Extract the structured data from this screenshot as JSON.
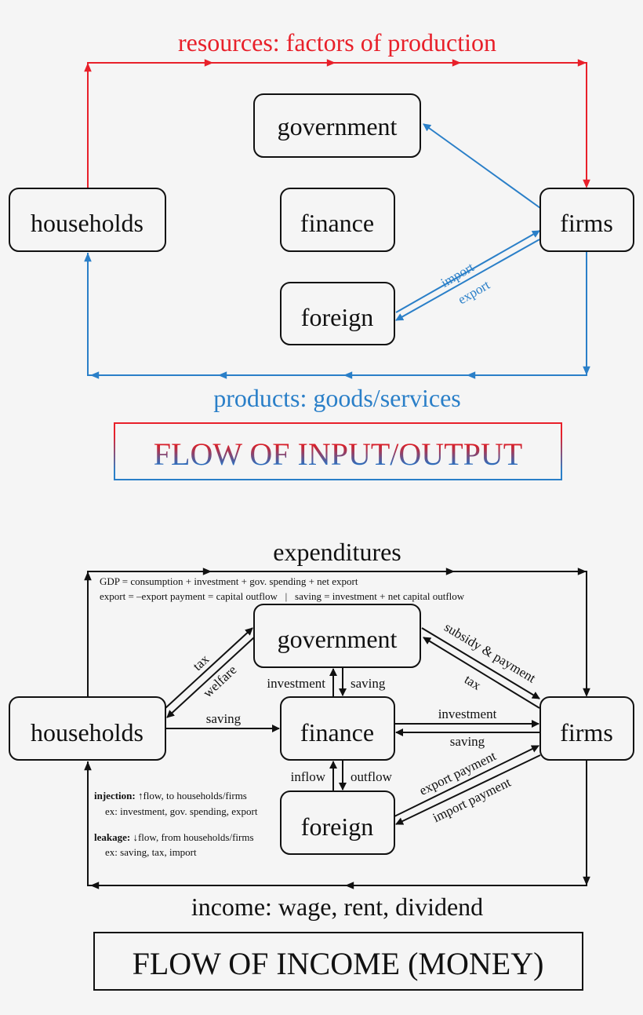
{
  "colors": {
    "input_flow": "#e8202a",
    "output_flow": "#2a7fc8",
    "money_flow": "#111111",
    "background": "#f5f5f5"
  },
  "top": {
    "resources_label": "resources: factors of production",
    "products_label": "products: goods/services",
    "title": "FLOW OF INPUT/OUTPUT",
    "nodes": {
      "government": "government",
      "households": "households",
      "finance": "finance",
      "firms": "firms",
      "foreign": "foreign"
    },
    "import_label": "import",
    "export_label": "export"
  },
  "bottom": {
    "expenditures_label": "expenditures",
    "gdp_note": "GDP = consumption + investment + gov. spending + net export",
    "export_note": "export = –export payment = capital outflow   |   saving = investment + net capital outflow",
    "income_label": "income: wage, rent, dividend",
    "title": "FLOW OF INCOME (MONEY)",
    "nodes": {
      "government": "government",
      "households": "households",
      "finance": "finance",
      "firms": "firms",
      "foreign": "foreign"
    },
    "flows": {
      "tax_households": "tax",
      "welfare": "welfare",
      "saving_households": "saving",
      "investment_gov": "investment",
      "saving_gov": "saving",
      "subsidy": "subsidy & payment",
      "tax_firms": "tax",
      "investment_firms": "investment",
      "saving_firms": "saving",
      "inflow": "inflow",
      "outflow": "outflow",
      "export_payment": "export payment",
      "import_payment": "import payment"
    },
    "legend": {
      "injection_term": "injection:",
      "injection_desc": "↑flow, to households/firms",
      "injection_ex": "ex: investment, gov. spending, export",
      "leakage_term": "leakage:",
      "leakage_desc": "↓flow, from households/firms",
      "leakage_ex": "ex: saving, tax, import"
    }
  }
}
